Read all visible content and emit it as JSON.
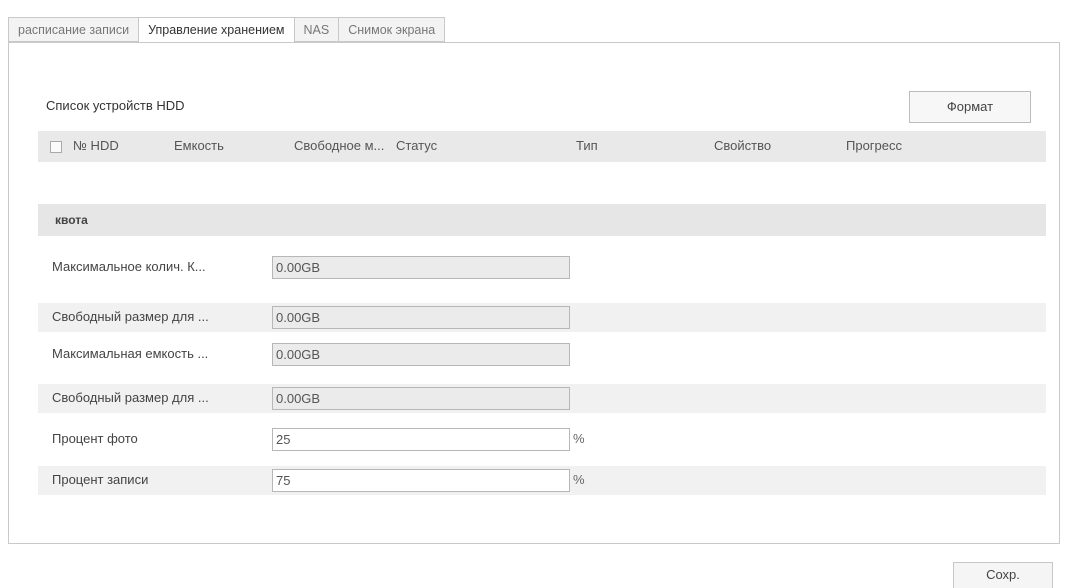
{
  "tabs": [
    {
      "label": "расписание записи"
    },
    {
      "label": "Управление хранением"
    },
    {
      "label": "NAS"
    },
    {
      "label": "Снимок экрана"
    }
  ],
  "hdd": {
    "title": "Список устройств HDD",
    "format_label": "Формат",
    "columns": [
      "№ HDD",
      "Емкость",
      "Свободное м...",
      "Статус",
      "Тип",
      "Свойство",
      "Прогресс"
    ]
  },
  "quota": {
    "title": "квота",
    "rows": [
      {
        "label": "Максимальное колич. К...",
        "value": "0.00GB",
        "readonly": true
      },
      {
        "label": "Свободный размер для ...",
        "value": "0.00GB",
        "readonly": true
      },
      {
        "label": "Максимальная емкость ...",
        "value": "0.00GB",
        "readonly": true
      },
      {
        "label": "Свободный размер для ...",
        "value": "0.00GB",
        "readonly": true
      },
      {
        "label": "Процент фото",
        "value": "25",
        "readonly": false,
        "unit": "%"
      },
      {
        "label": "Процент записи",
        "value": "75",
        "readonly": false,
        "unit": "%"
      }
    ]
  },
  "save_label": "Сохр."
}
